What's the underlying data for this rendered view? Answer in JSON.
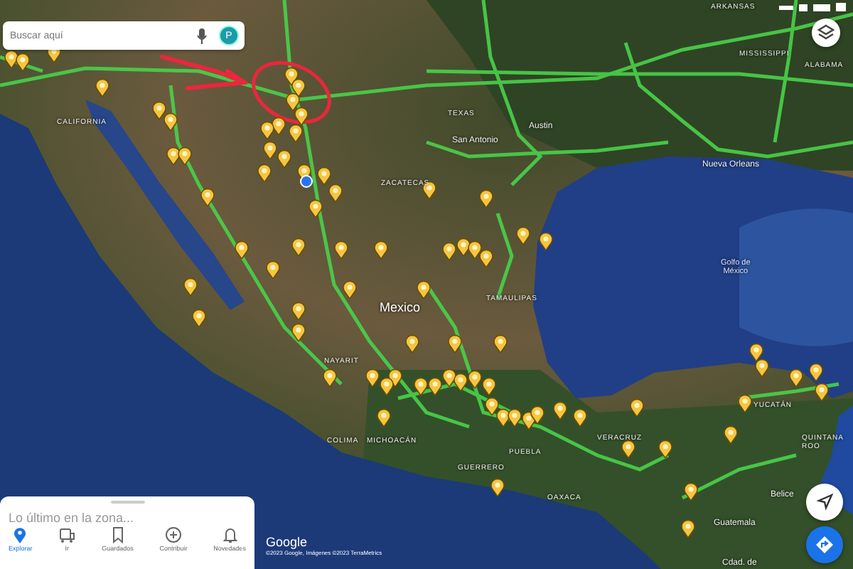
{
  "search": {
    "placeholder": "Buscar aquí",
    "avatar": "P"
  },
  "map_labels": [
    {
      "text": "ARKANSAS",
      "kind": "region"
    },
    {
      "text": "MISSISSIPPI",
      "kind": "region"
    },
    {
      "text": "ALABAMA",
      "kind": "region"
    },
    {
      "text": "TEXAS",
      "kind": "region"
    },
    {
      "text": "Austin",
      "kind": "city"
    },
    {
      "text": "San Antonio",
      "kind": "city"
    },
    {
      "text": "Nueva Orleans",
      "kind": "city"
    },
    {
      "text": "CALIFORNIA",
      "kind": "region"
    },
    {
      "text": "ZACATECAS",
      "kind": "region"
    },
    {
      "text": "Golfo de\nMéxico",
      "kind": "sea"
    },
    {
      "text": "Mexico",
      "kind": "country"
    },
    {
      "text": "TAMAULIPAS",
      "kind": "region"
    },
    {
      "text": "NAYARIT",
      "kind": "region"
    },
    {
      "text": "YUCATÁN",
      "kind": "region"
    },
    {
      "text": "COLIMA",
      "kind": "region"
    },
    {
      "text": "MICHOACÁN",
      "kind": "region"
    },
    {
      "text": "VERACRUZ",
      "kind": "region"
    },
    {
      "text": "QUINTANA\nROO",
      "kind": "region"
    },
    {
      "text": "PUEBLA",
      "kind": "region"
    },
    {
      "text": "GUERRERO",
      "kind": "region"
    },
    {
      "text": "OAXACA",
      "kind": "region"
    },
    {
      "text": "Belice",
      "kind": "city"
    },
    {
      "text": "Guatemala",
      "kind": "city"
    },
    {
      "text": "Cdad. de",
      "kind": "city"
    }
  ],
  "sheet": {
    "title": "Lo último en la zona...",
    "nav": [
      {
        "label": "Explorar",
        "selected": true
      },
      {
        "label": "Ir",
        "selected": false
      },
      {
        "label": "Guardados",
        "selected": false
      },
      {
        "label": "Contribuir",
        "selected": false
      },
      {
        "label": "Novedades",
        "selected": false
      }
    ]
  },
  "attribution": {
    "logo": "Google",
    "copyright": "©2023 Google, Imágenes ©2023 TerraMetrics"
  }
}
